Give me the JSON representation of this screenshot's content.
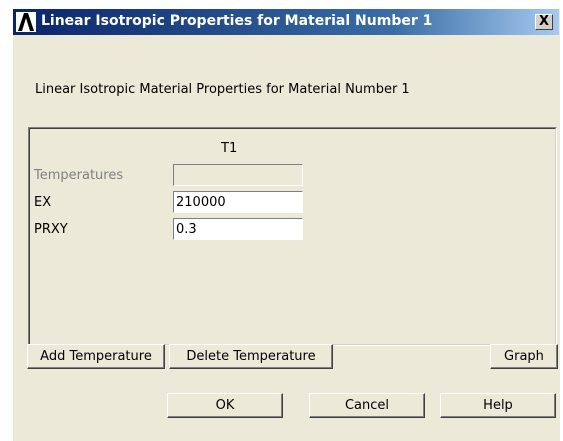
{
  "window": {
    "title": "Linear Isotropic Properties for Material Number 1",
    "close_label": "X"
  },
  "heading": "Linear Isotropic Material Properties for Material Number 1",
  "table": {
    "column_header": "T1",
    "rows": [
      {
        "label": "Temperatures",
        "value": "",
        "enabled": false
      },
      {
        "label": "EX",
        "value": "210000",
        "enabled": true
      },
      {
        "label": "PRXY",
        "value": "0.3",
        "enabled": true
      }
    ]
  },
  "buttons": {
    "add_temperature": "Add Temperature",
    "delete_temperature": "Delete Temperature",
    "graph": "Graph",
    "ok": "OK",
    "cancel": "Cancel",
    "help": "Help"
  },
  "colors": {
    "title_bar_start": "#0a246a",
    "title_bar_end": "#a6caf0",
    "dialog_bg": "#ece9d8"
  },
  "icons": {
    "app": "ansys-logo-icon",
    "close": "close-icon"
  }
}
